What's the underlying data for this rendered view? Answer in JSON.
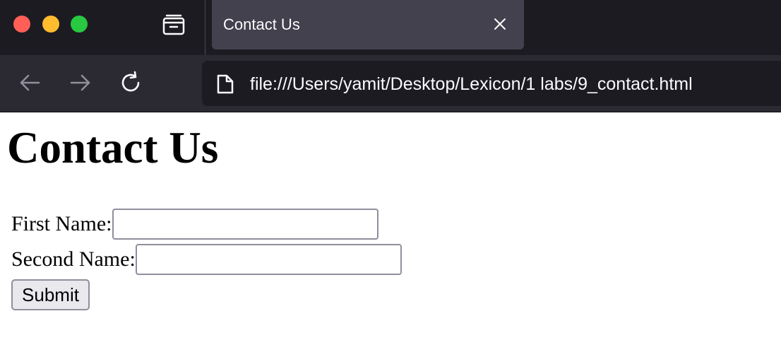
{
  "window": {
    "traffic_lights": {
      "close_color": "#ff5f57",
      "minimize_color": "#febc2e",
      "maximize_color": "#28c840"
    }
  },
  "tabs": [
    {
      "title": "Contact Us",
      "active": true,
      "close_icon": "close-icon"
    }
  ],
  "toolbar": {
    "back_icon": "back-arrow-icon",
    "forward_icon": "forward-arrow-icon",
    "reload_icon": "reload-icon",
    "tab_manager_icon": "tab-manager-icon"
  },
  "address_bar": {
    "page_icon": "page-icon",
    "url": "file:///Users/yamit/Desktop/Lexicon/1 labs/9_contact.html"
  },
  "page": {
    "heading": "Contact Us",
    "form": {
      "first_name_label": "First Name:",
      "first_name_value": "",
      "second_name_label": "Second Name:",
      "second_name_value": "",
      "submit_label": "Submit"
    }
  },
  "colors": {
    "titlebar_bg": "#1c1b22",
    "tab_bg": "#42414d",
    "navbar_bg": "#2b2a33",
    "urlbar_bg": "#1c1b22",
    "chrome_text": "#fbfbfe",
    "page_bg": "#ffffff"
  }
}
